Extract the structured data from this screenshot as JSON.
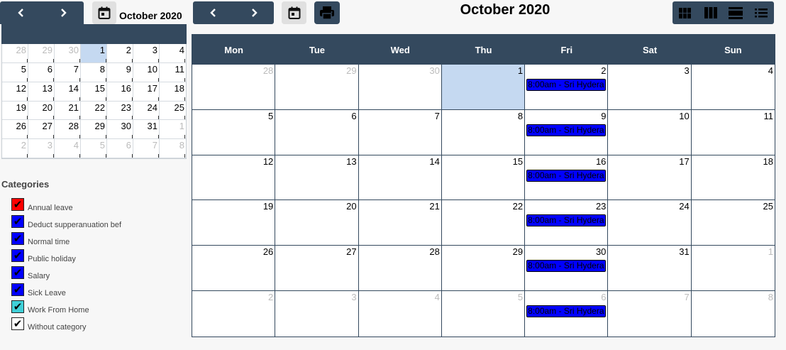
{
  "mini_calendar": {
    "title": "October 2020",
    "weeks": [
      [
        {
          "d": "28",
          "other": true
        },
        {
          "d": "29",
          "other": true
        },
        {
          "d": "30",
          "other": true
        },
        {
          "d": "1",
          "today": true
        },
        {
          "d": "2"
        },
        {
          "d": "3"
        },
        {
          "d": "4"
        }
      ],
      [
        {
          "d": "5"
        },
        {
          "d": "6"
        },
        {
          "d": "7"
        },
        {
          "d": "8"
        },
        {
          "d": "9"
        },
        {
          "d": "10"
        },
        {
          "d": "11"
        }
      ],
      [
        {
          "d": "12"
        },
        {
          "d": "13"
        },
        {
          "d": "14"
        },
        {
          "d": "15"
        },
        {
          "d": "16"
        },
        {
          "d": "17"
        },
        {
          "d": "18"
        }
      ],
      [
        {
          "d": "19"
        },
        {
          "d": "20"
        },
        {
          "d": "21"
        },
        {
          "d": "22"
        },
        {
          "d": "23"
        },
        {
          "d": "24"
        },
        {
          "d": "25"
        }
      ],
      [
        {
          "d": "26"
        },
        {
          "d": "27"
        },
        {
          "d": "28"
        },
        {
          "d": "29"
        },
        {
          "d": "30"
        },
        {
          "d": "31"
        },
        {
          "d": "1",
          "other": true
        }
      ],
      [
        {
          "d": "2",
          "other": true
        },
        {
          "d": "3",
          "other": true
        },
        {
          "d": "4",
          "other": true
        },
        {
          "d": "5",
          "other": true
        },
        {
          "d": "6",
          "other": true
        },
        {
          "d": "7",
          "other": true
        },
        {
          "d": "8",
          "other": true
        }
      ]
    ]
  },
  "categories": {
    "title": "Categories",
    "items": [
      {
        "label": "Annual leave",
        "color": "#ff0000",
        "checked": true
      },
      {
        "label": "Deduct supperanuation bef",
        "color": "#0000ff",
        "checked": true
      },
      {
        "label": "Normal time",
        "color": "#0000ff",
        "checked": true
      },
      {
        "label": "Public holiday",
        "color": "#0000ff",
        "checked": true
      },
      {
        "label": "Salary",
        "color": "#0000ff",
        "checked": true
      },
      {
        "label": "Sick Leave",
        "color": "#0000ff",
        "checked": true
      },
      {
        "label": "Work From Home",
        "color": "#40d0d8",
        "checked": true
      },
      {
        "label": "Without category",
        "color": "#ffffff",
        "checked": true
      }
    ]
  },
  "toolbar": {
    "title": "October 2020",
    "prev_icon": "chevron-left-icon",
    "next_icon": "chevron-right-icon",
    "today_icon": "calendar-today-icon",
    "print_icon": "printer-icon",
    "view_icons": [
      "month-view-icon",
      "week-view-icon",
      "day-view-icon",
      "list-view-icon"
    ]
  },
  "month": {
    "weekdays": [
      "Mon",
      "Tue",
      "Wed",
      "Thu",
      "Fri",
      "Sat",
      "Sun"
    ],
    "event_color": "#0000ff",
    "weeks": [
      [
        {
          "d": "28",
          "other": true
        },
        {
          "d": "29",
          "other": true
        },
        {
          "d": "30",
          "other": true
        },
        {
          "d": "1",
          "today": true
        },
        {
          "d": "2",
          "event": "8:00am - Sri Hydera"
        },
        {
          "d": "3"
        },
        {
          "d": "4"
        }
      ],
      [
        {
          "d": "5"
        },
        {
          "d": "6"
        },
        {
          "d": "7"
        },
        {
          "d": "8"
        },
        {
          "d": "9",
          "event": "8:00am - Sri Hydera"
        },
        {
          "d": "10"
        },
        {
          "d": "11"
        }
      ],
      [
        {
          "d": "12"
        },
        {
          "d": "13"
        },
        {
          "d": "14"
        },
        {
          "d": "15"
        },
        {
          "d": "16",
          "event": "8:00am - Sri Hydera"
        },
        {
          "d": "17"
        },
        {
          "d": "18"
        }
      ],
      [
        {
          "d": "19"
        },
        {
          "d": "20"
        },
        {
          "d": "21"
        },
        {
          "d": "22"
        },
        {
          "d": "23",
          "event": "8:00am - Sri Hydera"
        },
        {
          "d": "24"
        },
        {
          "d": "25"
        }
      ],
      [
        {
          "d": "26"
        },
        {
          "d": "27"
        },
        {
          "d": "28"
        },
        {
          "d": "29"
        },
        {
          "d": "30",
          "event": "8:00am - Sri Hydera"
        },
        {
          "d": "31"
        },
        {
          "d": "1",
          "other": true
        }
      ],
      [
        {
          "d": "2",
          "other": true
        },
        {
          "d": "3",
          "other": true
        },
        {
          "d": "4",
          "other": true
        },
        {
          "d": "5",
          "other": true
        },
        {
          "d": "6",
          "other": true,
          "event": "8:00am - Sri Hydera"
        },
        {
          "d": "7",
          "other": true
        },
        {
          "d": "8",
          "other": true
        }
      ]
    ]
  }
}
